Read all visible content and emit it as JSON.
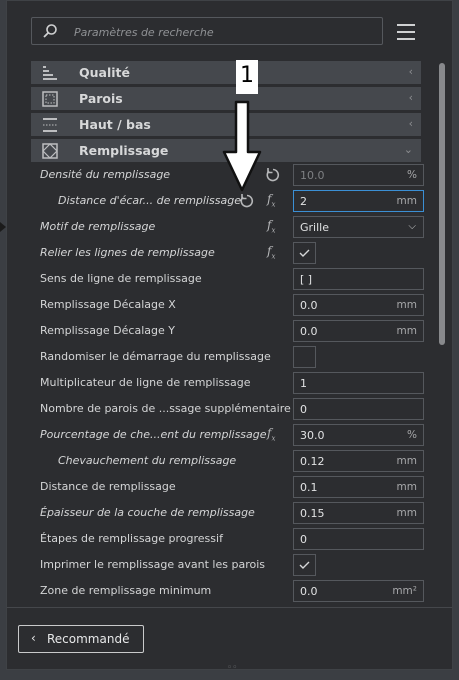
{
  "search": {
    "placeholder": "Paramètres de recherche"
  },
  "categories": [
    {
      "label": "Qualité",
      "icon": "quality-icon",
      "chevron": "‹"
    },
    {
      "label": "Parois",
      "icon": "walls-icon",
      "chevron": "‹"
    },
    {
      "label": "Haut / bas",
      "icon": "top-bottom-icon",
      "chevron": "‹"
    },
    {
      "label": "Remplissage",
      "icon": "infill-icon",
      "chevron": "⌄"
    }
  ],
  "settings": [
    {
      "label": "Densité du remplissage",
      "value": "10.0",
      "unit": "%",
      "italic": true
    },
    {
      "label": "Distance d'écar... de remplissage",
      "value": "2",
      "unit": "mm",
      "italic": true
    },
    {
      "label": "Motif de remplissage",
      "value": "Grille",
      "italic": true
    },
    {
      "label": "Relier les lignes de remplissage",
      "value": "✓",
      "italic": true
    },
    {
      "label": "Sens de ligne de remplissage",
      "value": "[ ]"
    },
    {
      "label": "Remplissage Décalage X",
      "value": "0.0",
      "unit": "mm"
    },
    {
      "label": "Remplissage Décalage Y",
      "value": "0.0",
      "unit": "mm"
    },
    {
      "label": "Randomiser le démarrage du remplissage",
      "value": ""
    },
    {
      "label": "Multiplicateur de ligne de remplissage",
      "value": "1"
    },
    {
      "label": "Nombre de parois de ...ssage supplémentaire",
      "value": "0"
    },
    {
      "label": "Pourcentage de che...ent du remplissage",
      "value": "30.0",
      "unit": "%",
      "italic": true
    },
    {
      "label": "Chevauchement du remplissage",
      "value": "0.12",
      "unit": "mm",
      "italic": true
    },
    {
      "label": "Distance de remplissage",
      "value": "0.1",
      "unit": "mm"
    },
    {
      "label": "Épaisseur de la couche de remplissage",
      "value": "0.15",
      "unit": "mm",
      "italic": true
    },
    {
      "label": "Étapes de remplissage progressif",
      "value": "0"
    },
    {
      "label": "Imprimer le remplissage avant les parois",
      "value": "✓"
    },
    {
      "label": "Zone de remplissage minimum",
      "value": "0.0",
      "unit": "mm²"
    }
  ],
  "fx_symbol": "f",
  "fx_sub": "x",
  "footer": {
    "recommend_label": "Recommandé",
    "arrow": "‹"
  },
  "annotation": {
    "number": "1"
  },
  "colors": {
    "focus": "#3b8fd4",
    "panel": "#2c2d30",
    "category": "#45484d"
  }
}
